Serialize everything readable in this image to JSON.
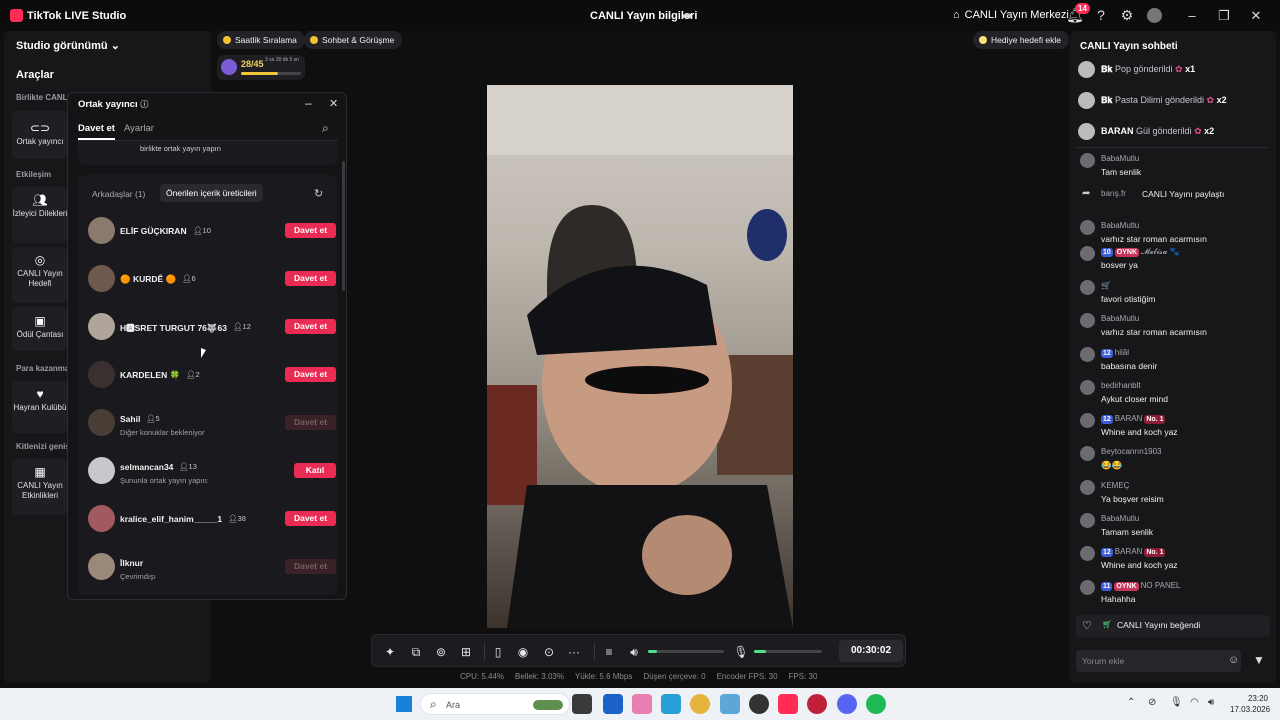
{
  "app": {
    "title": "TikTok LIVE Studio",
    "live_info": "CANLI Yayın bilgileri",
    "center_label": "CANLI Yayın Merkezi",
    "notif_count": "14"
  },
  "sidebar": {
    "studio_view": "Studio görünümü",
    "tools": "Araçlar",
    "section_together": "Birlikte CANLI",
    "cohost": "Ortak yayıncı",
    "section_interaction": "Etkileşim",
    "viewer_wishes": "İzleyici Dilekleri",
    "live_goal": "CANLI Yayın Hedefi",
    "reward_bag": "Ödül Çantası",
    "section_earn": "Para kazanma",
    "fan_club": "Hayran Kulübü",
    "section_audience": "Kitlenizi genişletin",
    "live_events": "CANLI Yayın Etkinlikleri"
  },
  "top_pills": {
    "hourly": "Saatlik Sıralama",
    "chat_meet": "Sohbet & Görüşme",
    "gift_goal": "Hediye hedefi ekle"
  },
  "progress": {
    "value": "28/45",
    "time": "3 sa 30 dk 5 sn",
    "fraction": 0.62
  },
  "modal": {
    "title": "Ortak yayıncı",
    "tab_invite": "Davet et",
    "tab_settings": "Ayarlar",
    "top_text": "birlikte ortak yayın yapın",
    "tab_friends": "Arkadaşlar (1)",
    "tab_suggested": "Önerilen içerik üreticileri",
    "rows": [
      {
        "name": "ELİF GÜÇKIRAN",
        "count": "10",
        "sub": "",
        "button": "Davet et",
        "disabled": false,
        "color": "#8a7a6c"
      },
      {
        "name": "🟠 KURDÊ 🟠",
        "count": "6",
        "sub": "",
        "button": "Davet et",
        "disabled": false,
        "color": "#6e5a4c"
      },
      {
        "name": "H🅰SRET TURGUT 76🐺63",
        "count": "12",
        "sub": "",
        "button": "Davet et",
        "disabled": false,
        "color": "#b0a59a"
      },
      {
        "name": "KARDELEN 🍀",
        "count": "2",
        "sub": "",
        "button": "Davet et",
        "disabled": false,
        "color": "#3a3030"
      },
      {
        "name": "Sahil",
        "count": "5",
        "sub": "Diğer konuklar bekleniyor",
        "button": "Davet et",
        "disabled": true,
        "color": "#4a3d36"
      },
      {
        "name": "selmancan34",
        "count": "13",
        "sub": "Şununla ortak yayın yapın:",
        "button": "Katıl",
        "disabled": false,
        "color": "#c8c8cc"
      },
      {
        "name": "kralice_elif_hanim_____1",
        "count": "38",
        "sub": "",
        "button": "Davet et",
        "disabled": false,
        "color": "#a05a60"
      },
      {
        "name": "İlknur",
        "count": "",
        "sub": "Çevrimdışı",
        "button": "Davet et",
        "disabled": true,
        "color": "#9a8878"
      }
    ]
  },
  "chat": {
    "title": "CANLI Yayın sohbeti",
    "gifts": [
      {
        "user": "𝐁𝐤",
        "text": "Pop gönderildi",
        "mult": "x1"
      },
      {
        "user": "𝐁𝐤",
        "text": "Pasta Dilimi gönderildi",
        "mult": "x2"
      },
      {
        "user": "BARAN",
        "text": "Gül gönderildi",
        "mult": "x2"
      }
    ],
    "messages": [
      {
        "user": "BabaMutlu",
        "text": "Tam senlik",
        "lvl": "",
        "badge": "",
        "no1": false
      },
      {
        "user": "barış.fr",
        "text": "CANLI Yayını paylaştı",
        "lvl": "",
        "badge": "",
        "no1": false,
        "inline": true
      },
      {
        "user": "BabaMutlu",
        "text": "varhız star roman acarmısın",
        "lvl": "",
        "badge": "",
        "no1": false
      },
      {
        "user": "𝓜𝓮𝓵𝓲𝓼𝓪 🐾",
        "text": "bosver ya",
        "lvl": "10",
        "badge": "OYNK",
        "no1": false
      },
      {
        "user": "🛒",
        "text": "favori otistiğim",
        "lvl": "",
        "badge": "",
        "no1": false
      },
      {
        "user": "BabaMutlu",
        "text": "varhız star roman acarmısın",
        "lvl": "",
        "badge": "",
        "no1": false
      },
      {
        "user": "hilâl",
        "text": "babasına denir",
        "lvl": "12",
        "badge": "",
        "no1": false
      },
      {
        "user": "bedirhanblt",
        "text": "Aykut closer mind",
        "lvl": "",
        "badge": "",
        "no1": false
      },
      {
        "user": "BARAN",
        "text": "Whine and koch yaz",
        "lvl": "12",
        "badge": "",
        "no1": true
      },
      {
        "user": "Beytocanrın1903",
        "text": "😂😂",
        "lvl": "",
        "badge": "",
        "no1": false
      },
      {
        "user": "KEMEÇ",
        "text": "Ya boşver reisim",
        "lvl": "",
        "badge": "",
        "no1": false
      },
      {
        "user": "BabaMutlu",
        "text": "Tamam senlik",
        "lvl": "",
        "badge": "",
        "no1": false
      },
      {
        "user": "BARAN",
        "text": "Whine and koch yaz",
        "lvl": "12",
        "badge": "",
        "no1": true
      },
      {
        "user": "NO PANEL",
        "text": "Hahahha",
        "lvl": "11",
        "badge": "OYNK",
        "no1": false
      }
    ],
    "liked": "CANLI Yayını beğendi",
    "no1_label": "No. 1",
    "comment_placeholder": "Yorum ekle"
  },
  "controls": {
    "timer": "00:30:02",
    "volume": 0.12,
    "mic": 0.18
  },
  "status": {
    "cpu": "CPU:  5.44%",
    "mem": "Bellek:  3.03%",
    "upload": "Yükle:  5.6 Mbps",
    "dropped": "Düşen çerçeve:  0",
    "enc_fps": "Encoder FPS:  30",
    "fps": "FPS:  30"
  },
  "taskbar": {
    "search": "Ara",
    "time": "23:20",
    "date": "17.03.2026"
  }
}
